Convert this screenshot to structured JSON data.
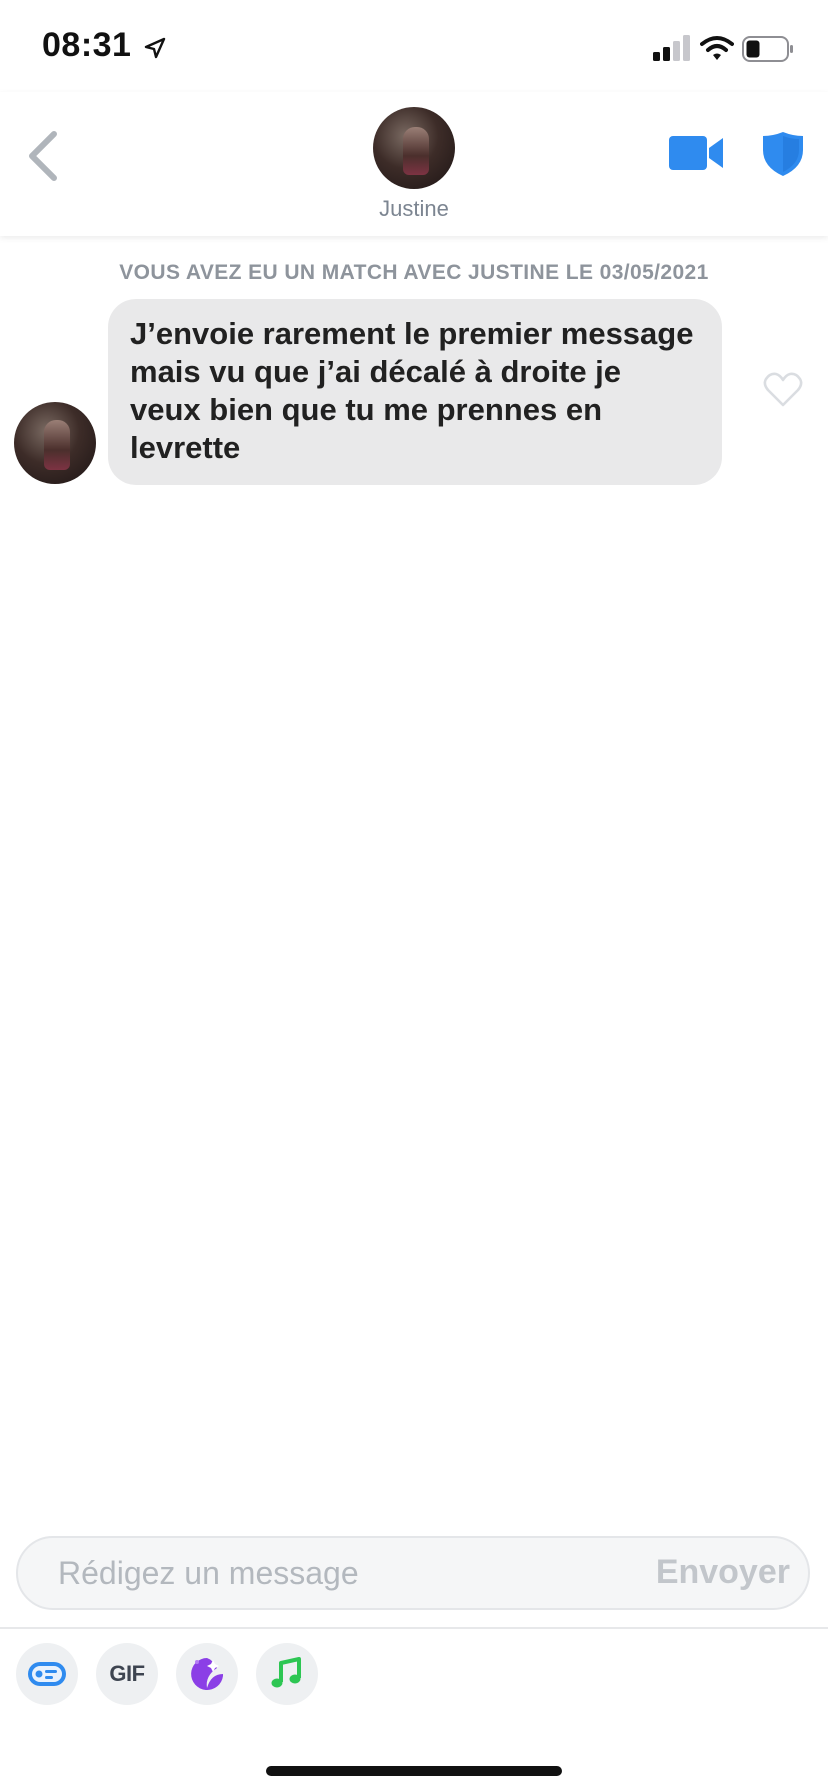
{
  "status_bar": {
    "time": "08:31",
    "icons": [
      "location-arrow-icon",
      "signal-icon",
      "wifi-icon",
      "battery-icon"
    ]
  },
  "header": {
    "back_icon": "chevron-left-icon",
    "name": "Justine",
    "video_icon": "video-camera-icon",
    "shield_icon": "shield-icon",
    "accent_color": "#2f8bef"
  },
  "conversation": {
    "match_banner": "VOUS AVEZ EU UN MATCH AVEC JUSTINE LE 03/05/2021",
    "messages": [
      {
        "sender": "Justine",
        "text": "J’envoie rarement le premier message mais vu que j’ai décalé à droite je veux bien que tu me prennes en levrette",
        "liked": false
      }
    ]
  },
  "composer": {
    "placeholder": "Rédigez un message",
    "value": "",
    "send_label": "Envoyer"
  },
  "tools": {
    "gif_label": "GIF",
    "icons": [
      "bitmoji-icon",
      "gif-icon",
      "sticker-icon",
      "music-icon"
    ]
  }
}
